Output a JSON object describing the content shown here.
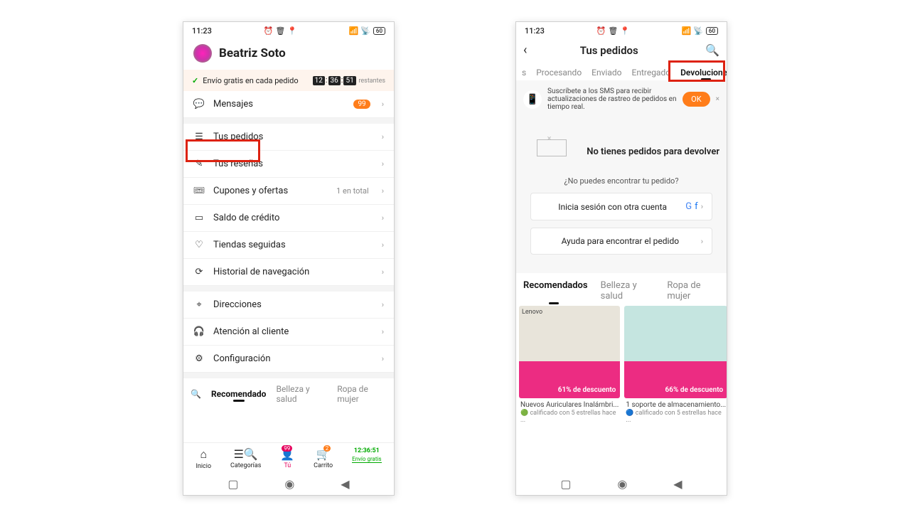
{
  "status": {
    "time": "11:23",
    "battery": "60"
  },
  "p1": {
    "username": "Beatriz Soto",
    "ship": {
      "text": "Envío gratis en cada pedido",
      "t1": "12",
      "t2": "36",
      "t3": "51",
      "rest": "restantes"
    },
    "rows": {
      "mensajes": "Mensajes",
      "msgBadge": "99",
      "pedidos": "Tus pedidos",
      "resenas": "Tus reseñas",
      "cupones": "Cupones y ofertas",
      "cupSub": "1 en total",
      "saldo": "Saldo de crédito",
      "tiendas": "Tiendas seguidas",
      "historial": "Historial de navegación",
      "direcciones": "Direcciones",
      "atencion": "Atención al cliente",
      "config": "Configuración"
    },
    "tabs": {
      "rec": "Recomendado",
      "bel": "Belleza y salud",
      "ropa": "Ropa de mujer"
    },
    "nav": {
      "inicio": "Inicio",
      "cat": "Categorías",
      "tu": "Tú",
      "carrito": "Carrito",
      "envio": "Envío gratis",
      "tuBadge": "99",
      "cartBadge": "2",
      "timer": "12:36:51"
    }
  },
  "p2": {
    "title": "Tus pedidos",
    "tabs": {
      "s": "s",
      "proc": "Procesando",
      "env": "Enviado",
      "ent": "Entregado",
      "dev": "Devoluciones"
    },
    "sms": {
      "text": "Suscríbete a los SMS para recibir actualizaciones de rastreo de pedidos en tiempo real.",
      "ok": "OK"
    },
    "empty": "No tienes pedidos para devolver",
    "find": "¿No puedes encontrar tu pedido?",
    "signin": "Inicia sesión con otra cuenta",
    "help": "Ayuda para encontrar el pedido",
    "tabs3": {
      "rec": "Recomendados",
      "bel": "Belleza y salud",
      "ropa": "Ropa de mujer"
    },
    "prods": {
      "p1": {
        "brand": "Lenovo",
        "disc": "61% de descuento",
        "title": "Nuevos Auriculares Inalámbri...",
        "rate": "calificado con 5 estrellas hace ..."
      },
      "p2": {
        "disc": "66% de descuento",
        "title": "1 soporte de almacenamiento...",
        "rate": "calificado con 5 estrellas hace ..."
      }
    }
  }
}
